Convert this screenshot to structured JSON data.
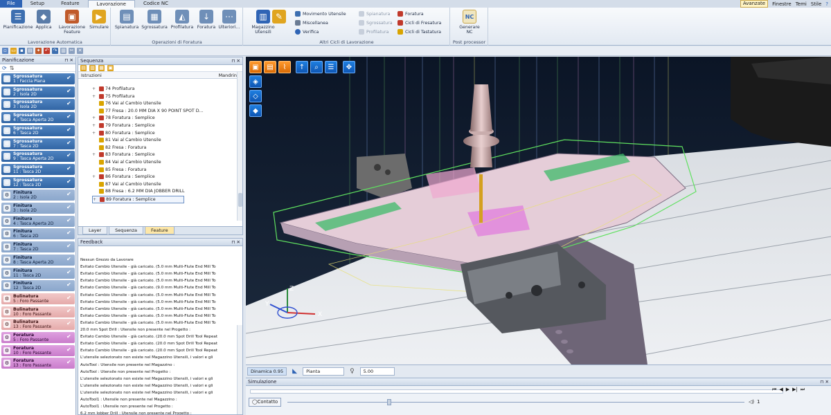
{
  "menu": {
    "tabs": [
      "File",
      "Setup",
      "Feature",
      "Lavorazione",
      "Codice NC"
    ],
    "active": "Lavorazione",
    "right": [
      "Avanzate",
      "Finestre",
      "Temi",
      "Stile"
    ]
  },
  "ribbon": {
    "groups": [
      {
        "label": "Lavorazione Automatica",
        "buttons": [
          "Pianificazione",
          "Applica",
          "Lavorazione Feature",
          "Simulare"
        ]
      },
      {
        "label": "Operazioni di Foratura",
        "buttons": [
          "Spianatura",
          "Sgrossatura",
          "Profilatura",
          "Foratura",
          "Ulteriori..."
        ]
      },
      {
        "label": "Altri Cicli di Lavorazione",
        "buttons": [
          "Magazzino Utensili"
        ],
        "small": [
          "Movimento Utensile",
          "Miscellanea",
          "Verifica",
          "Spianatura",
          "Sgrossatura",
          "Profilatura",
          "Foratura",
          "Cicli di Fresatura",
          "Cicli di Tastatura"
        ]
      },
      {
        "label": "Post processor",
        "buttons": [
          "Generare NC"
        ]
      }
    ]
  },
  "pianificazione": {
    "title": "Pianificazione",
    "ops": [
      {
        "t": "Sgrossatura",
        "s": "1 : Faccia Piana",
        "k": "rough"
      },
      {
        "t": "Sgrossatura",
        "s": "2 : Isola 2D",
        "k": "rough"
      },
      {
        "t": "Sgrossatura",
        "s": "3 : Isola 2D",
        "k": "rough"
      },
      {
        "t": "Sgrossatura",
        "s": "4 : Tasca Aperta 2D",
        "k": "rough"
      },
      {
        "t": "Sgrossatura",
        "s": "6 : Tasca 2D",
        "k": "rough"
      },
      {
        "t": "Sgrossatura",
        "s": "7 : Tasca 2D",
        "k": "rough"
      },
      {
        "t": "Sgrossatura",
        "s": "9 : Tasca Aperta 2D",
        "k": "rough"
      },
      {
        "t": "Sgrossatura",
        "s": "11 : Tasca 2D",
        "k": "rough"
      },
      {
        "t": "Sgrossatura",
        "s": "12 : Tasca 2D",
        "k": "rough"
      },
      {
        "t": "Finitura",
        "s": "2 : Isola 2D",
        "k": "fin"
      },
      {
        "t": "Finitura",
        "s": "3 : Isola 2D",
        "k": "fin"
      },
      {
        "t": "Finitura",
        "s": "4 : Tasca Aperta 2D",
        "k": "fin"
      },
      {
        "t": "Finitura",
        "s": "6 : Tasca 2D",
        "k": "fin"
      },
      {
        "t": "Finitura",
        "s": "7 : Tasca 2D",
        "k": "fin"
      },
      {
        "t": "Finitura",
        "s": "8 : Tasca Aperta 2D",
        "k": "fin"
      },
      {
        "t": "Finitura",
        "s": "11 : Tasca 2D",
        "k": "fin"
      },
      {
        "t": "Finitura",
        "s": "12 : Tasca 2D",
        "k": "fin"
      },
      {
        "t": "Bulinatura",
        "s": "5 : Foro Passante",
        "k": "bul"
      },
      {
        "t": "Bulinatura",
        "s": "10 : Foro Passante",
        "k": "bul"
      },
      {
        "t": "Bulinatura",
        "s": "13 : Foro Passante",
        "k": "bul"
      },
      {
        "t": "Foratura",
        "s": "5 : Foro Passante",
        "k": "for"
      },
      {
        "t": "Foratura",
        "s": "10 : Foro Passante",
        "k": "for"
      },
      {
        "t": "Foratura",
        "s": "13 : Foro Passante",
        "k": "for"
      }
    ]
  },
  "sequenza": {
    "title": "Sequenza",
    "col1": "Istruzioni",
    "col2": "Mandrino",
    "rows": [
      {
        "t": "74 Profilatura",
        "c": "#c0392b",
        "e": "+"
      },
      {
        "t": "75 Profilatura",
        "c": "#c0392b",
        "e": "+"
      },
      {
        "t": "76 Vai al Cambio Utensile",
        "c": "#d9a400",
        "e": ""
      },
      {
        "t": "77 Fresa : 20.0 MM DIA X 90 POINT SPOT D...",
        "c": "#d9a400",
        "e": ""
      },
      {
        "t": "78 Foratura : Semplice",
        "c": "#c0392b",
        "e": "+"
      },
      {
        "t": "79 Foratura : Semplice",
        "c": "#c0392b",
        "e": "+"
      },
      {
        "t": "80 Foratura : Semplice",
        "c": "#c0392b",
        "e": "+"
      },
      {
        "t": "81 Vai al Cambio Utensile",
        "c": "#d9a400",
        "e": ""
      },
      {
        "t": "82 Fresa : Foratura",
        "c": "#d9a400",
        "e": ""
      },
      {
        "t": "83 Foratura : Semplice",
        "c": "#c0392b",
        "e": "+"
      },
      {
        "t": "84 Vai al Cambio Utensile",
        "c": "#d9a400",
        "e": ""
      },
      {
        "t": "85 Fresa : Foratura",
        "c": "#d9a400",
        "e": ""
      },
      {
        "t": "86 Foratura : Semplice",
        "c": "#c0392b",
        "e": "+"
      },
      {
        "t": "87 Vai al Cambio Utensile",
        "c": "#d9a400",
        "e": ""
      },
      {
        "t": "88 Fresa : 6.2 MM DIA JOBBER DRILL",
        "c": "#d9a400",
        "e": ""
      },
      {
        "t": "89 Foratura : Semplice",
        "c": "#c0392b",
        "e": "+"
      }
    ],
    "tabs": [
      "Layer",
      "Sequenza",
      "Feature"
    ]
  },
  "feedback": {
    "title": "Feedback",
    "lines": [
      "Nessun Grezzo da Lavorare",
      "Evitato Cambio Utensile - già caricato. (5.0 mm Multi-Flute End Mill To",
      "Evitato Cambio Utensile - già caricato. (5.0 mm Multi-Flute End Mill To",
      "Evitato Cambio Utensile - già caricato. (5.0 mm Multi-Flute End Mill To",
      "Evitato Cambio Utensile - già caricato. (9.0 mm Multi-Flute End Mill To",
      "Evitato Cambio Utensile - già caricato. (5.0 mm Multi-Flute End Mill To",
      "Evitato Cambio Utensile - già caricato. (5.0 mm Multi-Flute End Mill To",
      "Evitato Cambio Utensile - già caricato. (5.0 mm Multi-Flute End Mill To",
      "Evitato Cambio Utensile - già caricato. (5.0 mm Multi-Flute End Mill To",
      "Evitato Cambio Utensile - già caricato. (5.0 mm Multi-Flute End Mill To",
      "20.0 mm Spot Drill : Utensile non presente nel Progetto :",
      "Evitato Cambio Utensile - già caricato. (20.0 mm Spot Drill Tool Repeat",
      "Evitato Cambio Utensile - già caricato. (20.0 mm Spot Drill Tool Repeat",
      "Evitato Cambio Utensile - già caricato. (20.0 mm Spot Drill Tool Repeat",
      "L'utensile selezionato non esiste nel Magazzino Utensili, i valori e gli",
      "AutoTool : Utensile non presente nel Magazzino :",
      "AutoTool : Utensile non presente nel Progetto :",
      "L'utensile selezionato non esiste nel Magazzino Utensili, i valori e gli",
      "L'utensile selezionato non esiste nel Magazzino Utensili, i valori e gli",
      "L'utensile selezionato non esiste nel Magazzino Utensili, i valori e gli",
      "AutoTool1 : Utensile non presente nel Magazzino :",
      "AutoTool1 : Utensile non presente nel Progetto :",
      "6.2 mm Jobber Drill : Utensile non presente nel Progetto :"
    ]
  },
  "viewport_bar": {
    "dynamic": "Dinamica 0.95",
    "view": "Pianta",
    "value": "5.00"
  },
  "simulazione": {
    "title": "Simulazione",
    "button": "Contatto",
    "counter": "1"
  },
  "axes": {
    "x": "X",
    "y": "Y",
    "z": "Z"
  }
}
